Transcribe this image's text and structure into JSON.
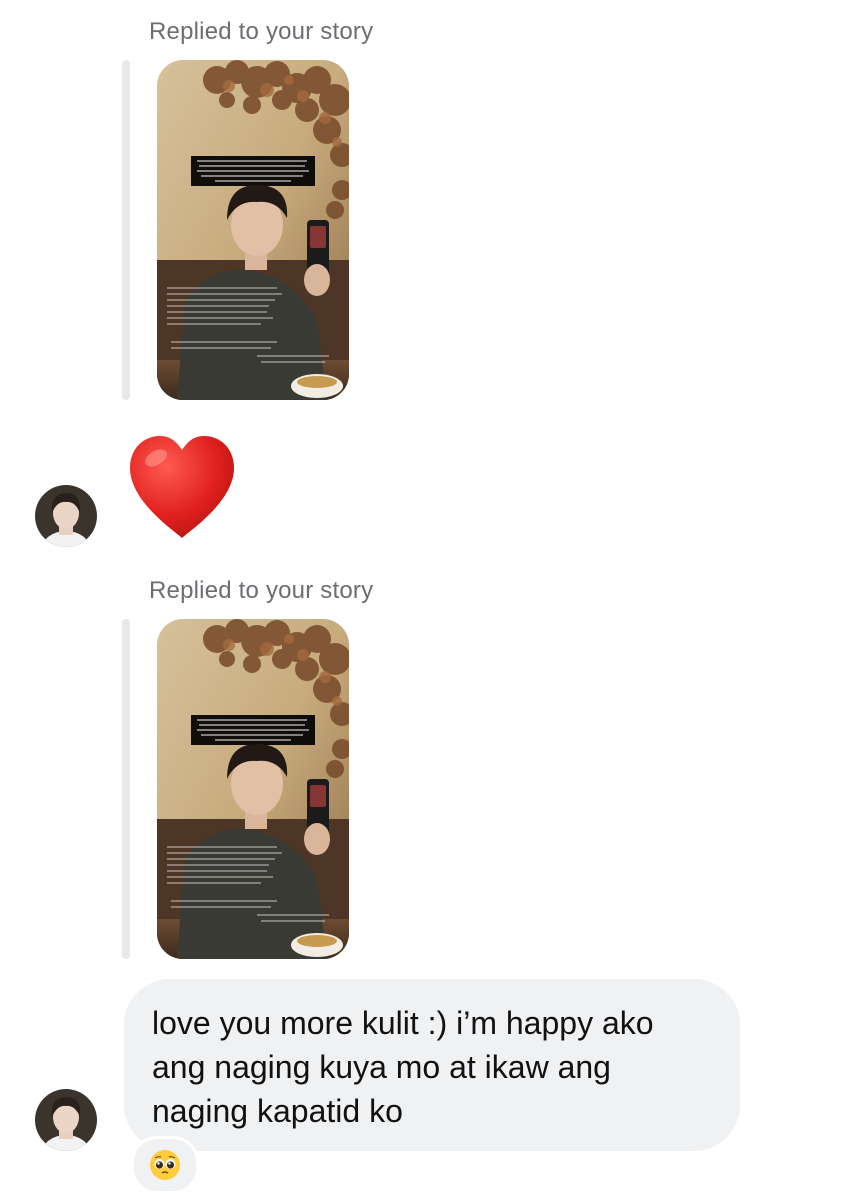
{
  "messages": [
    {
      "type": "story_reply",
      "label": "Replied to your story"
    },
    {
      "type": "reaction",
      "emoji": "❤️",
      "icon": "red-heart-icon"
    },
    {
      "type": "story_reply",
      "label": "Replied to your story"
    },
    {
      "type": "text",
      "lines": [
        "love you more kulit :) i’m happy ako",
        "ang naging kuya mo at ikaw ang",
        "naging kapatid ko"
      ],
      "reaction": {
        "emoji": "🥺",
        "icon": "pleading-face-icon"
      }
    }
  ],
  "colors": {
    "bubble": "#f0f1f3",
    "label": "#6b6e73",
    "heart": "#e0211f"
  }
}
